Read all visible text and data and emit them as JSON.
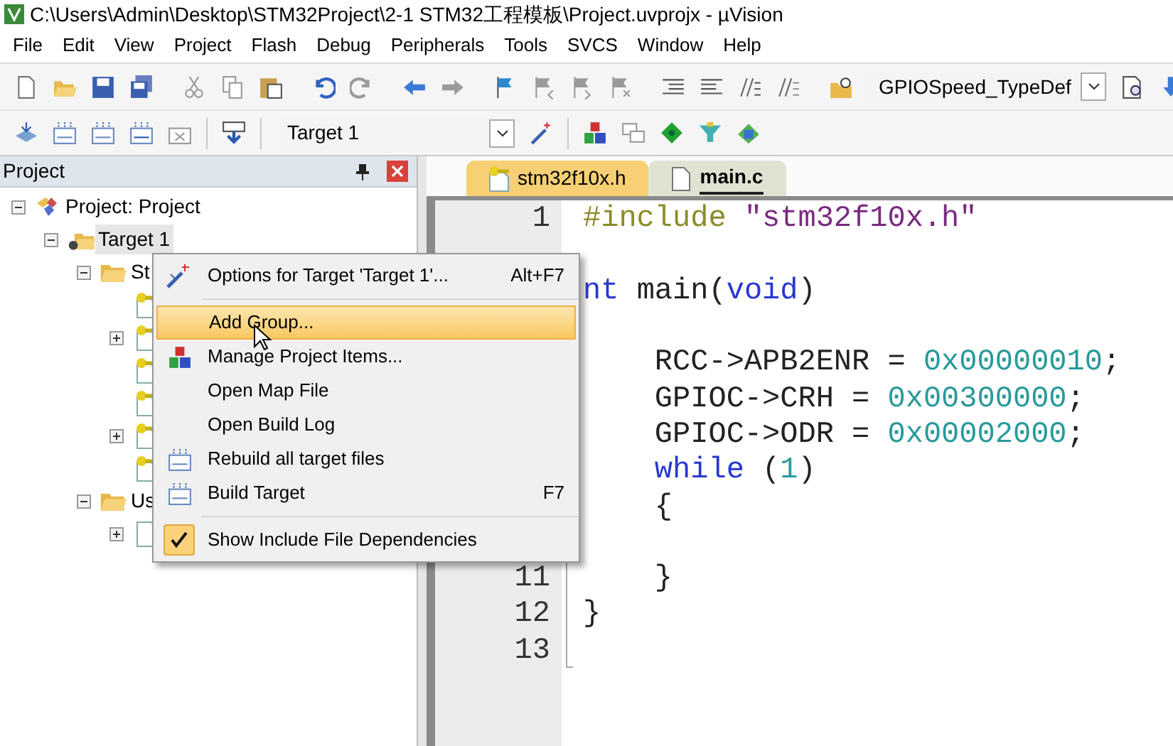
{
  "window": {
    "title": "C:\\Users\\Admin\\Desktop\\STM32Project\\2-1 STM32工程模板\\Project.uvprojx - µVision"
  },
  "menu_bar": [
    "File",
    "Edit",
    "View",
    "Project",
    "Flash",
    "Debug",
    "Peripherals",
    "Tools",
    "SVCS",
    "Window",
    "Help"
  ],
  "toolbar_1": [
    {
      "kind": "new",
      "disabled": false
    },
    {
      "kind": "open",
      "disabled": false
    },
    {
      "kind": "save",
      "disabled": false
    },
    {
      "kind": "save-all",
      "disabled": false
    },
    {
      "kind": "separator"
    },
    {
      "kind": "cut",
      "disabled": true
    },
    {
      "kind": "copy",
      "disabled": true
    },
    {
      "kind": "paste",
      "disabled": false
    },
    {
      "kind": "separator"
    },
    {
      "kind": "undo",
      "disabled": false
    },
    {
      "kind": "redo",
      "disabled": true
    },
    {
      "kind": "separator"
    },
    {
      "kind": "back",
      "disabled": false
    },
    {
      "kind": "forward",
      "disabled": true
    },
    {
      "kind": "separator"
    },
    {
      "kind": "flag",
      "disabled": false
    },
    {
      "kind": "flag-prev",
      "disabled": true
    },
    {
      "kind": "flag-next",
      "disabled": true
    },
    {
      "kind": "flag-clear",
      "disabled": true
    },
    {
      "kind": "separator"
    },
    {
      "kind": "indent",
      "disabled": false
    },
    {
      "kind": "unindent",
      "disabled": false
    },
    {
      "kind": "comment",
      "disabled": false
    },
    {
      "kind": "uncomment",
      "disabled": false
    },
    {
      "kind": "separator"
    },
    {
      "kind": "find-files",
      "disabled": false
    },
    {
      "kind": "combo",
      "value": "GPIOSpeed_TypeDef"
    },
    {
      "kind": "find-doc",
      "disabled": false
    },
    {
      "kind": "down-arrow",
      "disabled": false
    }
  ],
  "toolbar_2": [
    {
      "kind": "translate",
      "disabled": false
    },
    {
      "kind": "build",
      "disabled": false
    },
    {
      "kind": "rebuild",
      "disabled": false
    },
    {
      "kind": "batch",
      "disabled": false
    },
    {
      "kind": "stop",
      "disabled": true
    },
    {
      "kind": "separator"
    },
    {
      "kind": "download",
      "disabled": false
    },
    {
      "kind": "separator"
    },
    {
      "kind": "combo",
      "value": "Target 1"
    },
    {
      "kind": "wand",
      "disabled": false
    },
    {
      "kind": "separator"
    },
    {
      "kind": "blocks",
      "disabled": false
    },
    {
      "kind": "windows",
      "disabled": true
    },
    {
      "kind": "diamond",
      "disabled": false
    },
    {
      "kind": "funnel",
      "disabled": false
    },
    {
      "kind": "chips",
      "disabled": false
    }
  ],
  "project_panel": {
    "title": "Project",
    "tree": [
      {
        "kind": "project",
        "label": "Project: Project",
        "expanded": true,
        "selected": false,
        "children": [
          {
            "kind": "target",
            "label": "Target 1",
            "expanded": true,
            "selected": true,
            "children": [
              {
                "kind": "folder",
                "label": "St",
                "expanded": true,
                "selected": false,
                "children": [
                  {
                    "kind": "header",
                    "selected": false
                  },
                  {
                    "kind": "header",
                    "expanded": false,
                    "selected": false
                  },
                  {
                    "kind": "header",
                    "selected": false
                  },
                  {
                    "kind": "header",
                    "selected": false
                  },
                  {
                    "kind": "header",
                    "expanded": false,
                    "selected": false
                  },
                  {
                    "kind": "header",
                    "selected": false
                  }
                ]
              },
              {
                "kind": "folder",
                "label": "Us",
                "expanded": true,
                "selected": false,
                "children": [
                  {
                    "kind": "file",
                    "expanded": false,
                    "selected": false
                  }
                ]
              }
            ]
          }
        ]
      }
    ]
  },
  "editor": {
    "tabs": [
      {
        "kind": "header",
        "label": "stm32f10x.h",
        "selected": false
      },
      {
        "kind": "source",
        "label": "main.c",
        "selected": true
      }
    ],
    "lines": [
      {
        "kind": "code",
        "number": "1",
        "tokens": [
          {
            "kind": "preprocessor",
            "text": "#include "
          },
          {
            "kind": "string",
            "text": "\"stm32f10x.h\""
          }
        ]
      },
      {
        "kind": "blank"
      },
      {
        "kind": "code",
        "tokens": [
          {
            "kind": "keyword",
            "text": "nt"
          },
          {
            "kind": "plain",
            "text": " main("
          },
          {
            "kind": "keyword",
            "text": "void"
          },
          {
            "kind": "plain",
            "text": ")"
          }
        ]
      },
      {
        "kind": "blank"
      },
      {
        "kind": "code",
        "tokens": [
          {
            "kind": "plain",
            "text": "    RCC->APB2ENR = "
          },
          {
            "kind": "number",
            "text": "0x00000010"
          },
          {
            "kind": "plain",
            "text": ";"
          }
        ]
      },
      {
        "kind": "code",
        "tokens": [
          {
            "kind": "plain",
            "text": "    GPIOC->CRH = "
          },
          {
            "kind": "number",
            "text": "0x00300000"
          },
          {
            "kind": "plain",
            "text": ";"
          }
        ]
      },
      {
        "kind": "code",
        "tokens": [
          {
            "kind": "plain",
            "text": "    GPIOC->ODR = "
          },
          {
            "kind": "number",
            "text": "0x00002000"
          },
          {
            "kind": "plain",
            "text": ";"
          }
        ]
      },
      {
        "kind": "code",
        "tokens": [
          {
            "kind": "keyword",
            "text": "    while"
          },
          {
            "kind": "plain",
            "text": " ("
          },
          {
            "kind": "number",
            "text": "1"
          },
          {
            "kind": "plain",
            "text": ")"
          }
        ]
      },
      {
        "kind": "code",
        "tokens": [
          {
            "kind": "plain",
            "text": "    {"
          }
        ]
      },
      {
        "kind": "blank"
      },
      {
        "kind": "code",
        "number": "11",
        "tokens": [
          {
            "kind": "plain",
            "text": "    }"
          }
        ]
      },
      {
        "kind": "code",
        "number": "12",
        "tokens": [
          {
            "kind": "plain",
            "text": "}"
          }
        ]
      },
      {
        "kind": "blank",
        "number": "13"
      }
    ]
  },
  "context_menu": {
    "items": [
      {
        "kind": "wand",
        "label": "Options for Target 'Target 1'...",
        "shortcut": "Alt+F7",
        "selected": false
      },
      {
        "kind": "separator"
      },
      {
        "kind": "plain",
        "label": "Add Group...",
        "selected": true
      },
      {
        "kind": "blocks",
        "label": "Manage Project Items...",
        "selected": false
      },
      {
        "kind": "plain",
        "label": "Open Map File",
        "selected": false
      },
      {
        "kind": "plain",
        "label": "Open Build Log",
        "selected": false
      },
      {
        "kind": "rebuild",
        "label": "Rebuild all target files",
        "selected": false
      },
      {
        "kind": "build",
        "label": "Build Target",
        "shortcut": "F7",
        "selected": false
      },
      {
        "kind": "separator"
      },
      {
        "kind": "check",
        "label": "Show Include File Dependencies",
        "checked": true,
        "selected": false
      }
    ]
  }
}
